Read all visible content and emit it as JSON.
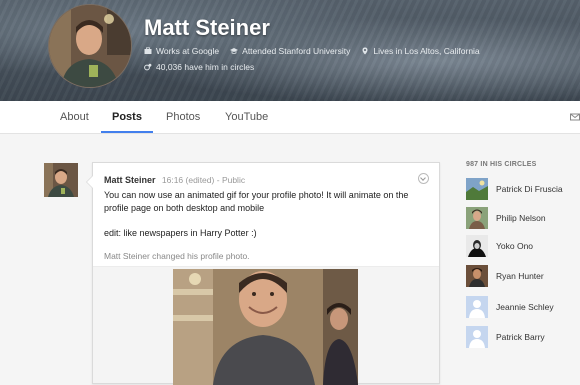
{
  "profile": {
    "name": "Matt Steiner",
    "work": "Works at Google",
    "school": "Attended Stanford University",
    "location": "Lives in Los Altos, California",
    "circles_count": "40,036 have him in circles"
  },
  "tabs": [
    {
      "label": "About",
      "active": false
    },
    {
      "label": "Posts",
      "active": true
    },
    {
      "label": "Photos",
      "active": false
    },
    {
      "label": "YouTube",
      "active": false
    }
  ],
  "post": {
    "author": "Matt Steiner",
    "time": "16:16 (edited)",
    "separator": "-",
    "visibility": "Public",
    "text": "You can now use an animated gif for your profile photo!  It will animate on the profile page on both desktop and mobile",
    "edit": "edit:  like newspapers in Harry Potter :)",
    "activity": "Matt Steiner changed his profile photo."
  },
  "circles": {
    "title": "987 IN HIS CIRCLES",
    "people": [
      {
        "name": "Patrick Di Fruscia",
        "avatar": "landscape-photo"
      },
      {
        "name": "Philip Nelson",
        "avatar": "person-photo"
      },
      {
        "name": "Yoko Ono",
        "avatar": "person-photo"
      },
      {
        "name": "Ryan Hunter",
        "avatar": "person-photo"
      },
      {
        "name": "Jeannie Schley",
        "avatar": "default-avatar"
      },
      {
        "name": "Patrick Barry",
        "avatar": "default-avatar"
      }
    ]
  },
  "colors": {
    "tab_accent": "#427fed",
    "default_avatar_bg": "#c5d6ef"
  }
}
